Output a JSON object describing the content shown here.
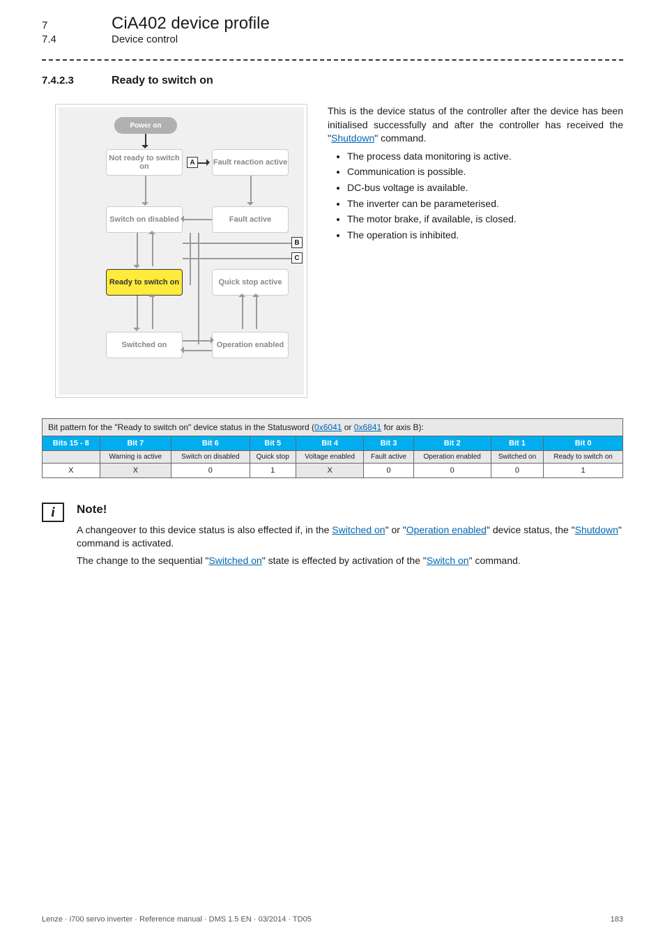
{
  "header": {
    "chapter_num": "7",
    "chapter_title": "CiA402 device profile",
    "section_num": "7.4",
    "section_title": "Device control"
  },
  "section": {
    "num": "7.4.2.3",
    "title": "Ready to switch on"
  },
  "diagram": {
    "power_on": "Power on",
    "not_ready": "Not ready to switch on",
    "fault_reaction": "Fault reaction active",
    "switch_on_disabled": "Switch on disabled",
    "fault_active": "Fault active",
    "ready_to_switch_on": "Ready to switch on",
    "quick_stop_active": "Quick stop active",
    "switched_on": "Switched on",
    "operation_enabled": "Operation enabled",
    "tag_a": "A",
    "tag_b": "B",
    "tag_c": "C"
  },
  "desc": {
    "intro_pre": "This is the device status of the controller after the device has been initialised successfully and after the controller has received the \"",
    "intro_link": "Shutdown",
    "intro_post": "\" command.",
    "bullets": [
      "The process data monitoring is active.",
      "Communication is possible.",
      "DC-bus voltage is available.",
      "The inverter can be parameterised.",
      "The motor brake, if available, is closed.",
      "The operation is inhibited."
    ]
  },
  "table": {
    "caption_pre": "Bit pattern for the \"Ready to switch on\" device status in the Statusword (",
    "caption_link1": "0x6041",
    "caption_mid": " or ",
    "caption_link2": "0x6841",
    "caption_post": " for axis B):",
    "headers": [
      "Bits 15 - 8",
      "Bit 7",
      "Bit 6",
      "Bit 5",
      "Bit 4",
      "Bit 3",
      "Bit 2",
      "Bit 1",
      "Bit 0"
    ],
    "labels": [
      "",
      "Warning is active",
      "Switch on disabled",
      "Quick stop",
      "Voltage enabled",
      "Fault active",
      "Operation enabled",
      "Switched on",
      "Ready to switch on"
    ],
    "values": [
      "X",
      "X",
      "0",
      "1",
      "X",
      "0",
      "0",
      "0",
      "1"
    ]
  },
  "note": {
    "title": "Note!",
    "p1_a": "A changeover to this device status is also effected if, in the ",
    "p1_l1": "Switched on",
    "p1_b": "\" or \"",
    "p1_l2": "Operation enabled",
    "p1_c": "\" device status, the \"",
    "p1_l3": "Shutdown",
    "p1_d": "\" command is activated.",
    "p2_a": "The change to the sequential \"",
    "p2_l1": "Switched on",
    "p2_b": "\" state is effected by activation of the \"",
    "p2_l2": "Switch on",
    "p2_c": "\" command."
  },
  "footer": {
    "left": "Lenze · i700 servo inverter · Reference manual · DMS 1.5 EN · 03/2014 · TD05",
    "right": "183"
  },
  "chart_data": {
    "type": "table",
    "title": "Bit pattern for the \"Ready to switch on\" device status in the Statusword (0x6041 or 0x6841 for axis B)",
    "columns": [
      "Bits 15 - 8",
      "Bit 7",
      "Bit 6",
      "Bit 5",
      "Bit 4",
      "Bit 3",
      "Bit 2",
      "Bit 1",
      "Bit 0"
    ],
    "signal_names": [
      "",
      "Warning is active",
      "Switch on disabled",
      "Quick stop",
      "Voltage enabled",
      "Fault active",
      "Operation enabled",
      "Switched on",
      "Ready to switch on"
    ],
    "values": [
      "X",
      "X",
      "0",
      "1",
      "X",
      "0",
      "0",
      "0",
      "1"
    ]
  }
}
